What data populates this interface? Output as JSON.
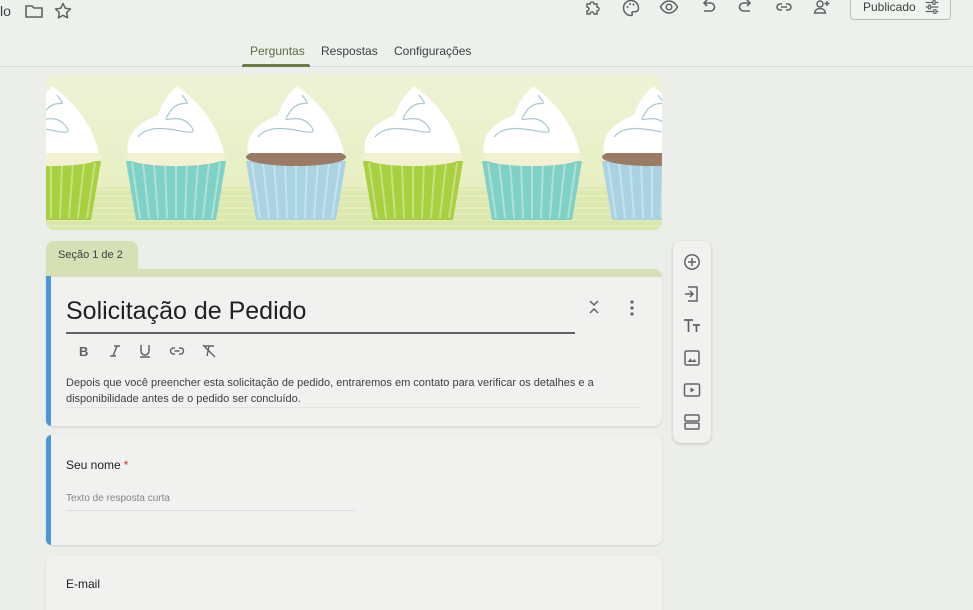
{
  "app": {
    "title_fragment": "lo",
    "publish_label": "Publicado"
  },
  "tabs": [
    {
      "label": "Perguntas",
      "active": true
    },
    {
      "label": "Respostas",
      "active": false
    },
    {
      "label": "Configurações",
      "active": false
    }
  ],
  "toolbar_icons": [
    "folder-icon",
    "star-icon",
    "addon-puzzle-icon",
    "palette-icon",
    "preview-eye-icon",
    "undo-icon",
    "redo-icon",
    "link-icon",
    "add-collaborator-icon",
    "publish-settings-icon"
  ],
  "section": {
    "label": "Seção 1 de 2"
  },
  "form": {
    "title": "Solicitação de Pedido",
    "description": "Depois que você preencher esta solicitação de pedido, entraremos em contato para verificar os detalhes e a disponibilidade antes de o pedido ser concluído."
  },
  "format_buttons": [
    "bold-icon",
    "italic-icon",
    "underline-icon",
    "link-icon",
    "clear-format-icon"
  ],
  "questions": [
    {
      "label": "Seu nome",
      "required": true,
      "required_mark": "*",
      "placeholder": "Texto de resposta curta"
    },
    {
      "label": "E-mail",
      "required": false
    }
  ],
  "side_tools": [
    "add-question-icon",
    "import-questions-icon",
    "add-title-icon",
    "add-image-icon",
    "add-video-icon",
    "add-section-icon"
  ],
  "colors": {
    "accent_blue": "#4a98d9",
    "section_tab": "#d7e0b5",
    "background": "#eceeea",
    "required": "#d93025"
  }
}
